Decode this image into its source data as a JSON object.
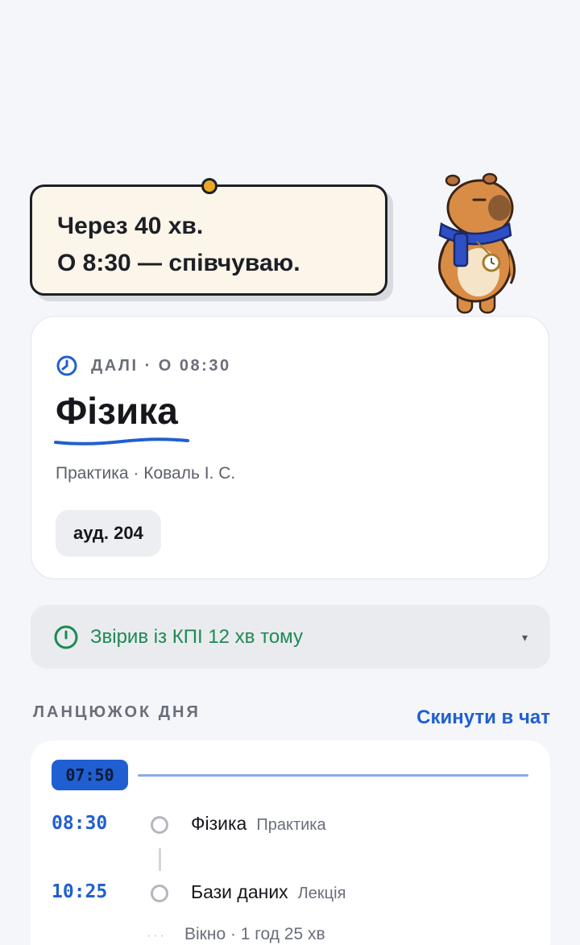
{
  "bubble": {
    "line1": "Через 40 хв.",
    "line2": "О 8:30 — співчуваю."
  },
  "next": {
    "label": "ДАЛІ · О 08:30",
    "subject": "Фізика",
    "meta": "Практика · Коваль І. С.",
    "room": "ауд. 204"
  },
  "sync": {
    "text": "Звірив із КПІ 12 хв тому",
    "caret": "▾"
  },
  "chain": {
    "title": "ЛАНЦЮЖОК ДНЯ",
    "share_label": "Скинути в чат",
    "now": "07:50",
    "items": [
      {
        "time": "08:30",
        "name": "Фізика",
        "type": "Практика"
      },
      {
        "time": "10:25",
        "name": "Бази даних",
        "type": "Лекція"
      }
    ],
    "gap": "Вікно · 1 год 25 хв",
    "gap_dots": "···"
  },
  "colors": {
    "accent": "#1f5fd1",
    "success": "#1e8a52",
    "bubble_bg": "#fbf6e9",
    "pin": "#e9a926"
  }
}
